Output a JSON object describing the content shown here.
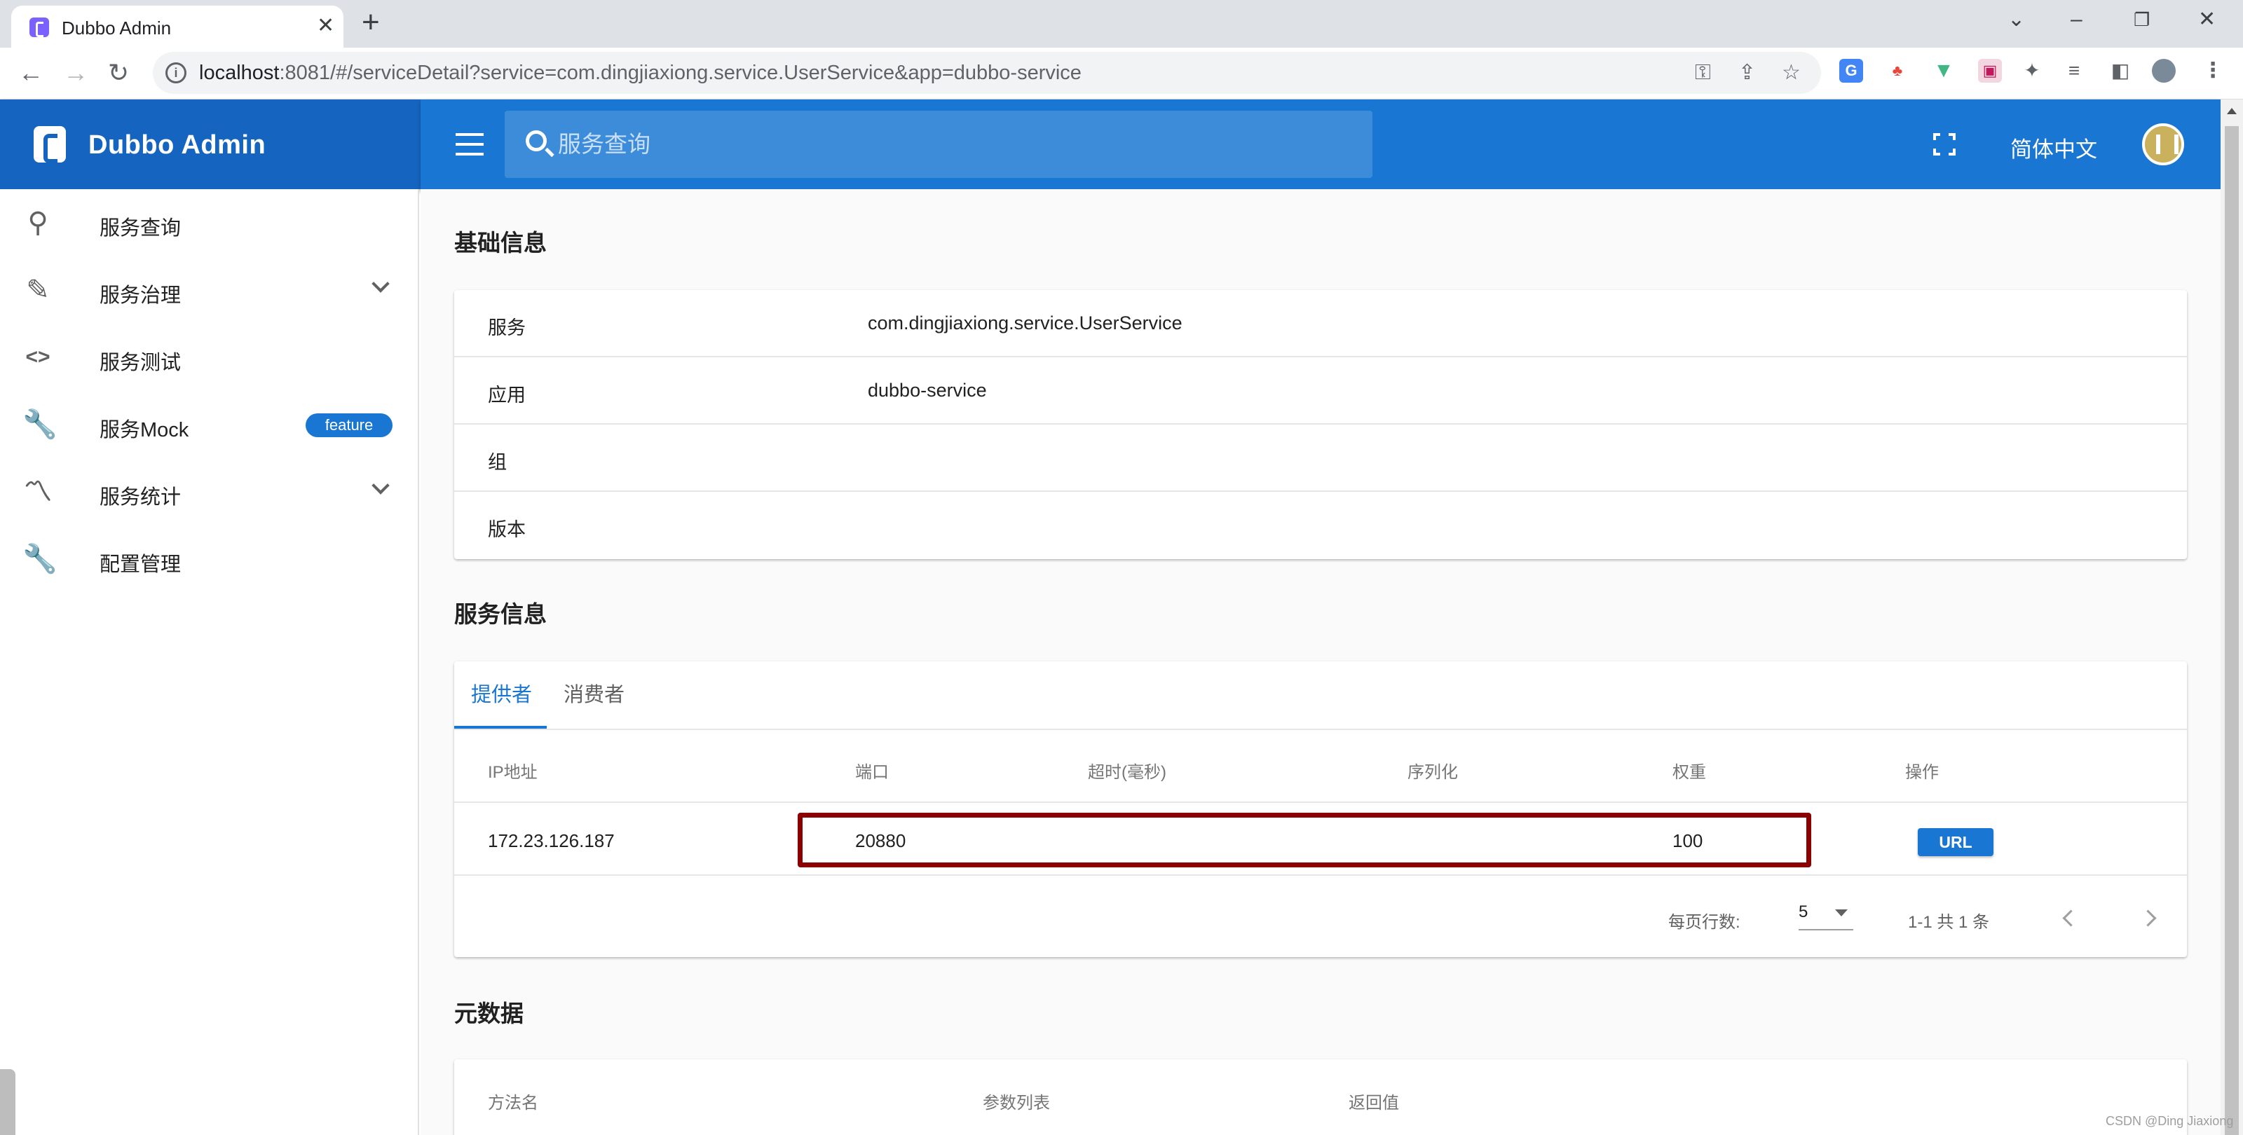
{
  "browser": {
    "tab_title": "Dubbo Admin",
    "url_host": "localhost",
    "url_rest": ":8081/#/serviceDetail?service=com.dingjiaxiong.service.UserService&app=dubbo-service"
  },
  "header": {
    "brand": "Dubbo Admin",
    "search_placeholder": "服务查询",
    "language": "简体中文"
  },
  "sidebar": {
    "items": [
      {
        "label": "服务查询",
        "icon": "search-icon"
      },
      {
        "label": "服务治理",
        "icon": "pencil-icon",
        "expandable": true
      },
      {
        "label": "服务测试",
        "icon": "code-icon"
      },
      {
        "label": "服务Mock",
        "icon": "wrench-icon",
        "badge": "feature"
      },
      {
        "label": "服务统计",
        "icon": "trending-icon",
        "expandable": true
      },
      {
        "label": "配置管理",
        "icon": "wrench-icon"
      }
    ]
  },
  "basic_info": {
    "title": "基础信息",
    "rows": [
      {
        "label": "服务",
        "value": "com.dingjiaxiong.service.UserService"
      },
      {
        "label": "应用",
        "value": "dubbo-service"
      },
      {
        "label": "组",
        "value": ""
      },
      {
        "label": "版本",
        "value": ""
      }
    ]
  },
  "service_info": {
    "title": "服务信息",
    "tabs": [
      "提供者",
      "消费者"
    ],
    "columns": [
      "IP地址",
      "端口",
      "超时(毫秒)",
      "序列化",
      "权重",
      "操作"
    ],
    "rows": [
      {
        "ip": "172.23.126.187",
        "port": "20880",
        "timeout": "",
        "serialization": "",
        "weight": "100",
        "action": "URL"
      }
    ],
    "pager": {
      "rows_per_page_label": "每页行数:",
      "rows_per_page": "5",
      "range": "1-1 共 1 条"
    }
  },
  "metadata": {
    "title": "元数据",
    "columns": [
      "方法名",
      "参数列表",
      "返回值"
    ]
  },
  "watermark": "CSDN @Ding Jiaxiong",
  "colors": {
    "primary": "#1976d2",
    "brand_bar": "#1565c0",
    "highlight": "#8b0000"
  }
}
